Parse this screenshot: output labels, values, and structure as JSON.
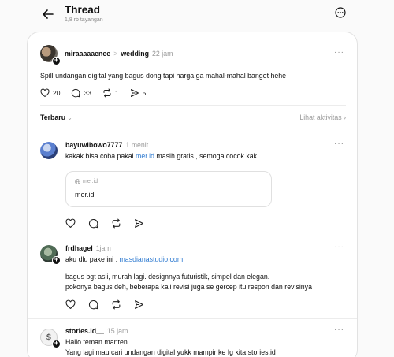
{
  "header": {
    "title": "Thread",
    "views": "1,8 rb tayangan"
  },
  "post": {
    "username": "miraaaaaenee",
    "topic": "wedding",
    "time": "22 jam",
    "text": "Spill undangan digital yang bagus dong tapi harga ga mahal-mahal banget hehe",
    "likes": "20",
    "comments": "33",
    "reposts": "1",
    "shares": "5"
  },
  "sort": {
    "label": "Terbaru",
    "activity": "Lihat aktivitas"
  },
  "replies": [
    {
      "username": "bayuwibowo7777",
      "time": "1 menit",
      "text_before": "kakak bisa coba pakai ",
      "link": "mer.id",
      "text_after": " masih gratis , semoga cocok kak",
      "card_domain": "mer.id",
      "card_title": "mer.id"
    },
    {
      "username": "frdhagel",
      "time": "1jam",
      "text_before": "aku dlu pake ini : ",
      "link": "masdianastudio.com",
      "line2": "bagus bgt asli, murah lagi. designnya futuristik, simpel dan elegan.",
      "line3": "pokonya bagus deh, beberapa kali revisi juga se gercep itu respon dan revisinya"
    },
    {
      "username": "stories.id__",
      "time": "15 jam",
      "line1": "Hallo teman manten",
      "line2": "Yang lagi mau cari undangan digital yukk mampir ke Ig kita stories.id",
      "avatar_text": "$"
    }
  ]
}
